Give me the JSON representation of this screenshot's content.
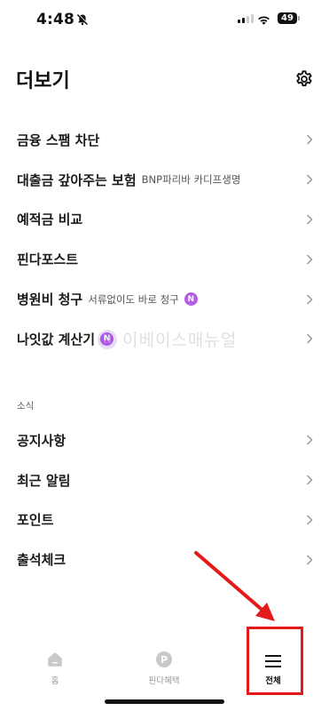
{
  "status_bar": {
    "time": "4:48",
    "battery": "49"
  },
  "header": {
    "title": "더보기"
  },
  "menu_items": [
    {
      "label": "금융 스팸 차단",
      "sub": "",
      "badge": ""
    },
    {
      "label": "대출금 갚아주는 보험",
      "sub": "BNP파리바 카디프생명",
      "badge": ""
    },
    {
      "label": "예적금 비교",
      "sub": "",
      "badge": ""
    },
    {
      "label": "핀다포스트",
      "sub": "",
      "badge": ""
    },
    {
      "label": "병원비 청구",
      "sub": "서류없이도 바로 청구",
      "badge": "N"
    },
    {
      "label": "나잇값 계산기",
      "sub": "",
      "badge": "N"
    }
  ],
  "watermark": {
    "badge": "N",
    "text": "이베이스매뉴얼"
  },
  "news_section": {
    "title": "소식",
    "items": [
      {
        "label": "공지사항"
      },
      {
        "label": "최근 알림"
      },
      {
        "label": "포인트"
      },
      {
        "label": "출석체크"
      }
    ]
  },
  "tab_bar": {
    "home": "홈",
    "benefit": "핀다혜택",
    "benefit_icon_letter": "P",
    "all": "전체"
  },
  "colors": {
    "accent_badge": "#b45de6",
    "highlight": "#e41a1a"
  }
}
